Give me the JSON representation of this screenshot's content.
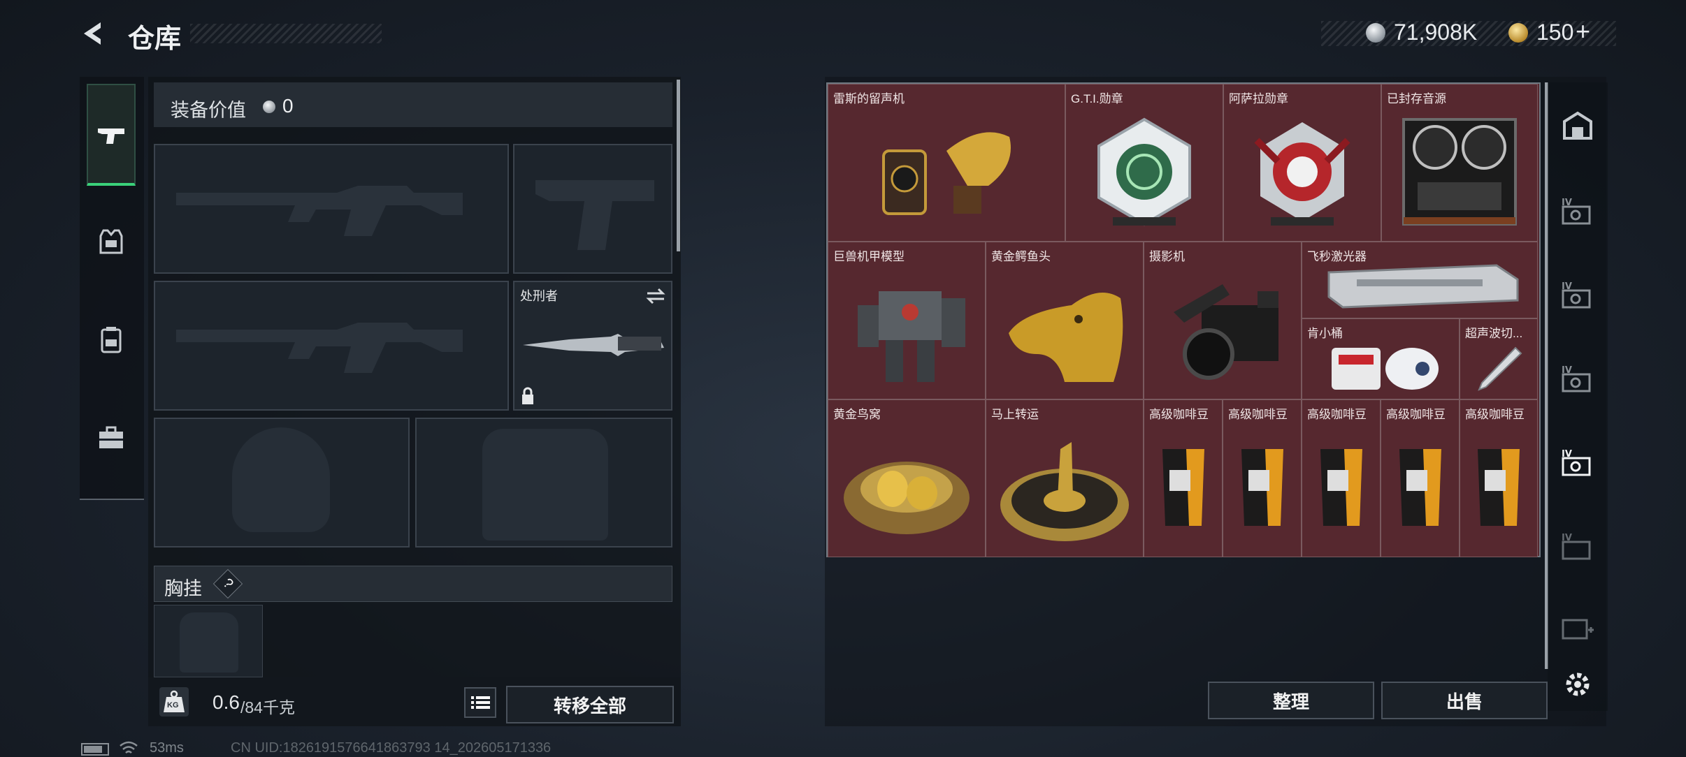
{
  "header": {
    "title": "仓库",
    "currency_silver": "71,908K",
    "currency_gold": "150",
    "gold_add": "+"
  },
  "left_tabs": [
    {
      "icon": "pistol-icon"
    },
    {
      "icon": "vest-icon"
    },
    {
      "icon": "backpack-icon"
    },
    {
      "icon": "toolbox-icon"
    }
  ],
  "equipment": {
    "value_label": "装备价值",
    "value": "0",
    "melee_name": "处刑者",
    "chest_rig_label": "胸挂",
    "help": "?",
    "weight_current": "0.6",
    "weight_max": "/84千克",
    "weight_icon_text": "KG",
    "transfer_all": "转移全部"
  },
  "storage_items": [
    {
      "name": "雷斯的留声机",
      "icon": "gramophone-icon"
    },
    {
      "name": "G.T.I.勋章",
      "icon": "gti-medal-icon"
    },
    {
      "name": "阿萨拉勋章",
      "icon": "asala-medal-icon"
    },
    {
      "name": "已封存音源",
      "icon": "tape-recorder-icon"
    },
    {
      "name": "巨兽机甲模型",
      "icon": "mech-model-icon"
    },
    {
      "name": "黄金鳄鱼头",
      "icon": "gold-croc-head-icon"
    },
    {
      "name": "摄影机",
      "icon": "camera-icon"
    },
    {
      "name": "飞秒激光器",
      "icon": "laser-icon"
    },
    {
      "name": "肯小桶",
      "icon": "bucket-icon"
    },
    {
      "name": "超声波切...",
      "icon": "ultrasonic-cutter-icon"
    },
    {
      "name": "黄金鸟窝",
      "icon": "gold-nest-icon"
    },
    {
      "name": "马上转运",
      "icon": "fortune-wheel-icon"
    },
    {
      "name": "高级咖啡豆",
      "icon": "coffee-bag-icon"
    },
    {
      "name": "高级咖啡豆",
      "icon": "coffee-bag-icon"
    },
    {
      "name": "高级咖啡豆",
      "icon": "coffee-bag-icon"
    },
    {
      "name": "高级咖啡豆",
      "icon": "coffee-bag-icon"
    },
    {
      "name": "高级咖啡豆",
      "icon": "coffee-bag-icon"
    }
  ],
  "storage_buttons": {
    "sort": "整理",
    "sell": "出售"
  },
  "right_tabs": [
    {
      "icon": "home-storage-icon"
    },
    {
      "icon": "case-iv-icon"
    },
    {
      "icon": "case-iv-icon"
    },
    {
      "icon": "case-iv-icon"
    },
    {
      "icon": "case-iv-icon"
    },
    {
      "icon": "case-iv-icon"
    },
    {
      "icon": "add-case-icon"
    },
    {
      "icon": "gear-icon"
    }
  ],
  "status_bar": {
    "ping": "53ms",
    "uid": "CN UID:1826191576641863793 14_202605171336"
  },
  "colors": {
    "item_bg": "#56282f",
    "active_tab": "#3ad17a"
  }
}
